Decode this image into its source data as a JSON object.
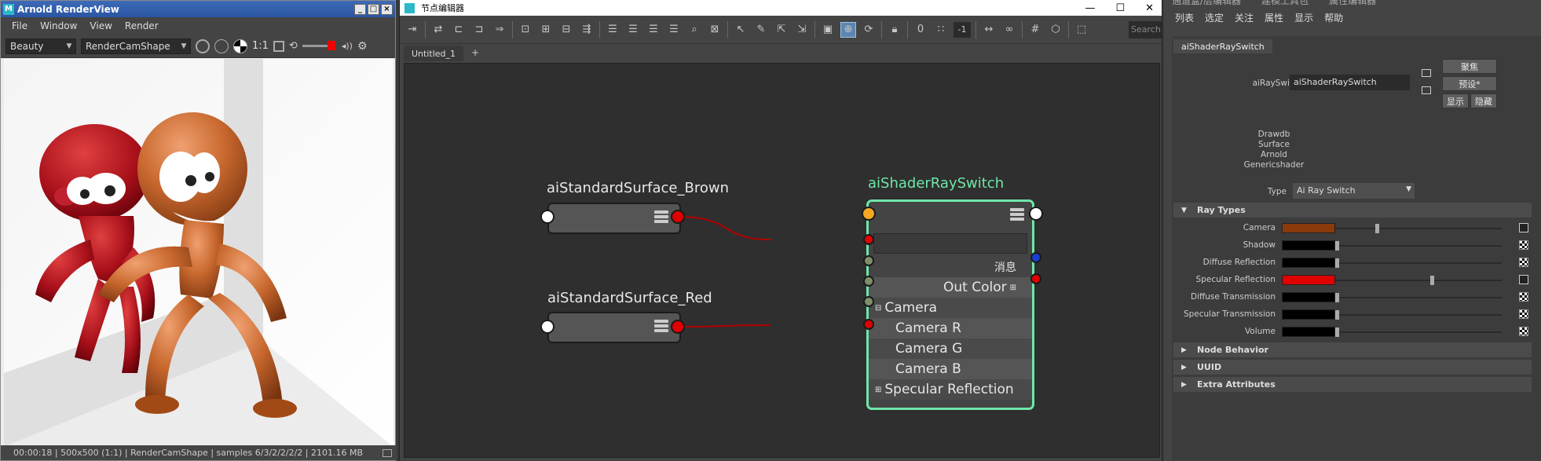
{
  "render_view": {
    "title": "Arnold RenderView",
    "menu": [
      "File",
      "Window",
      "View",
      "Render"
    ],
    "aov_value": "Beauty",
    "camera_value": "RenderCamShape",
    "ratio_label": "1:1",
    "status": "00:00:18 | 500x500 (1:1) | RenderCamShape  | samples 6/3/2/2/2/2 | 2101.16 MB"
  },
  "node_editor": {
    "title": "节点编辑器",
    "tab": "Untitled_1",
    "tab_add": "+",
    "toolbar_value": "-1",
    "toolbar_zero": "0",
    "search_placeholder": "Search...",
    "nodes": {
      "brown": {
        "title": "aiStandardSurface_Brown"
      },
      "red": {
        "title": "aiStandardSurface_Red"
      },
      "switch": {
        "title": "aiShaderRaySwitch",
        "message": "消息",
        "out_color": "Out Color",
        "camera": "Camera",
        "camera_r": "Camera R",
        "camera_g": "Camera G",
        "camera_b": "Camera B",
        "specular": "Specular Reflection"
      }
    }
  },
  "attr_editor": {
    "top_tabs": [
      "通道盒/层编辑器",
      "建模工具包",
      "属性编辑器"
    ],
    "menu": [
      "列表",
      "选定",
      "关注",
      "属性",
      "显示",
      "帮助"
    ],
    "node_tab": "aiShaderRaySwitch",
    "name_label": "aiRaySwitch:",
    "name_value": "aiShaderRaySwitch",
    "buttons": {
      "focus": "聚焦",
      "presets": "预设*",
      "show": "显示",
      "hide": "隐藏"
    },
    "classification": [
      "Drawdb",
      "Surface",
      "Arnold",
      "Genericshader"
    ],
    "type_label": "Type",
    "type_value": "Ai Ray Switch",
    "sections": {
      "ray_types": "Ray Types",
      "node_behavior": "Node Behavior",
      "uuid": "UUID",
      "extra": "Extra Attributes"
    },
    "ray_types": [
      {
        "label": "Camera",
        "color": "#8a3a0b",
        "slider": 0.24,
        "mapped": true
      },
      {
        "label": "Shadow",
        "color": "#000000",
        "slider": 0.0,
        "mapped": false
      },
      {
        "label": "Diffuse Reflection",
        "color": "#000000",
        "slider": 0.0,
        "mapped": false
      },
      {
        "label": "Specular Reflection",
        "color": "#e00000",
        "slider": 0.57,
        "mapped": true
      },
      {
        "label": "Diffuse Transmission",
        "color": "#000000",
        "slider": 0.0,
        "mapped": false
      },
      {
        "label": "Specular Transmission",
        "color": "#000000",
        "slider": 0.0,
        "mapped": false
      },
      {
        "label": "Volume",
        "color": "#000000",
        "slider": 0.0,
        "mapped": false
      }
    ]
  }
}
